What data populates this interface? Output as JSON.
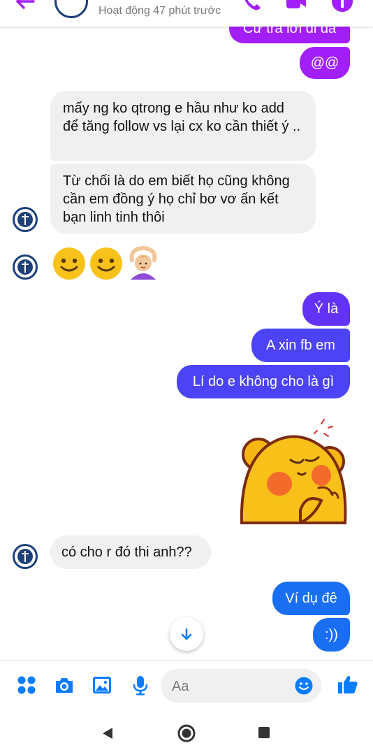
{
  "header": {
    "status": "Hoạt động 47 phút trước"
  },
  "messages": {
    "m0": "Cứ trả lời đi đã",
    "m1": "@@",
    "m2": "mấy ng ko qtrong e hầu như ko add để tăng follow vs lại cx ko cần thiết ý ..",
    "m3": "Từ chối là do em biết họ cũng không cần em đồng ý họ chỉ bơ vơ ấn kết bạn linh tinh thôi",
    "m4": "Ý là",
    "m5": "A xin fb em",
    "m6": "Lí do e không cho là gì",
    "m7": "có cho r đó thi anh??",
    "m8": "Ví dụ đê",
    "m9": ":))"
  },
  "composer": {
    "placeholder": "Aa"
  },
  "colors": {
    "accent": "#0a7cff",
    "bubble_purple": "#a21ffa",
    "bubble_blue": "#1a6ef2",
    "incoming": "#f0f0f0"
  },
  "icons": [
    "back-arrow-icon",
    "phone-icon",
    "video-camera-icon",
    "info-icon",
    "menu-dots-icon",
    "camera-icon",
    "gallery-icon",
    "microphone-icon",
    "emoji-icon",
    "thumbs-up-icon",
    "chevron-down-icon"
  ]
}
